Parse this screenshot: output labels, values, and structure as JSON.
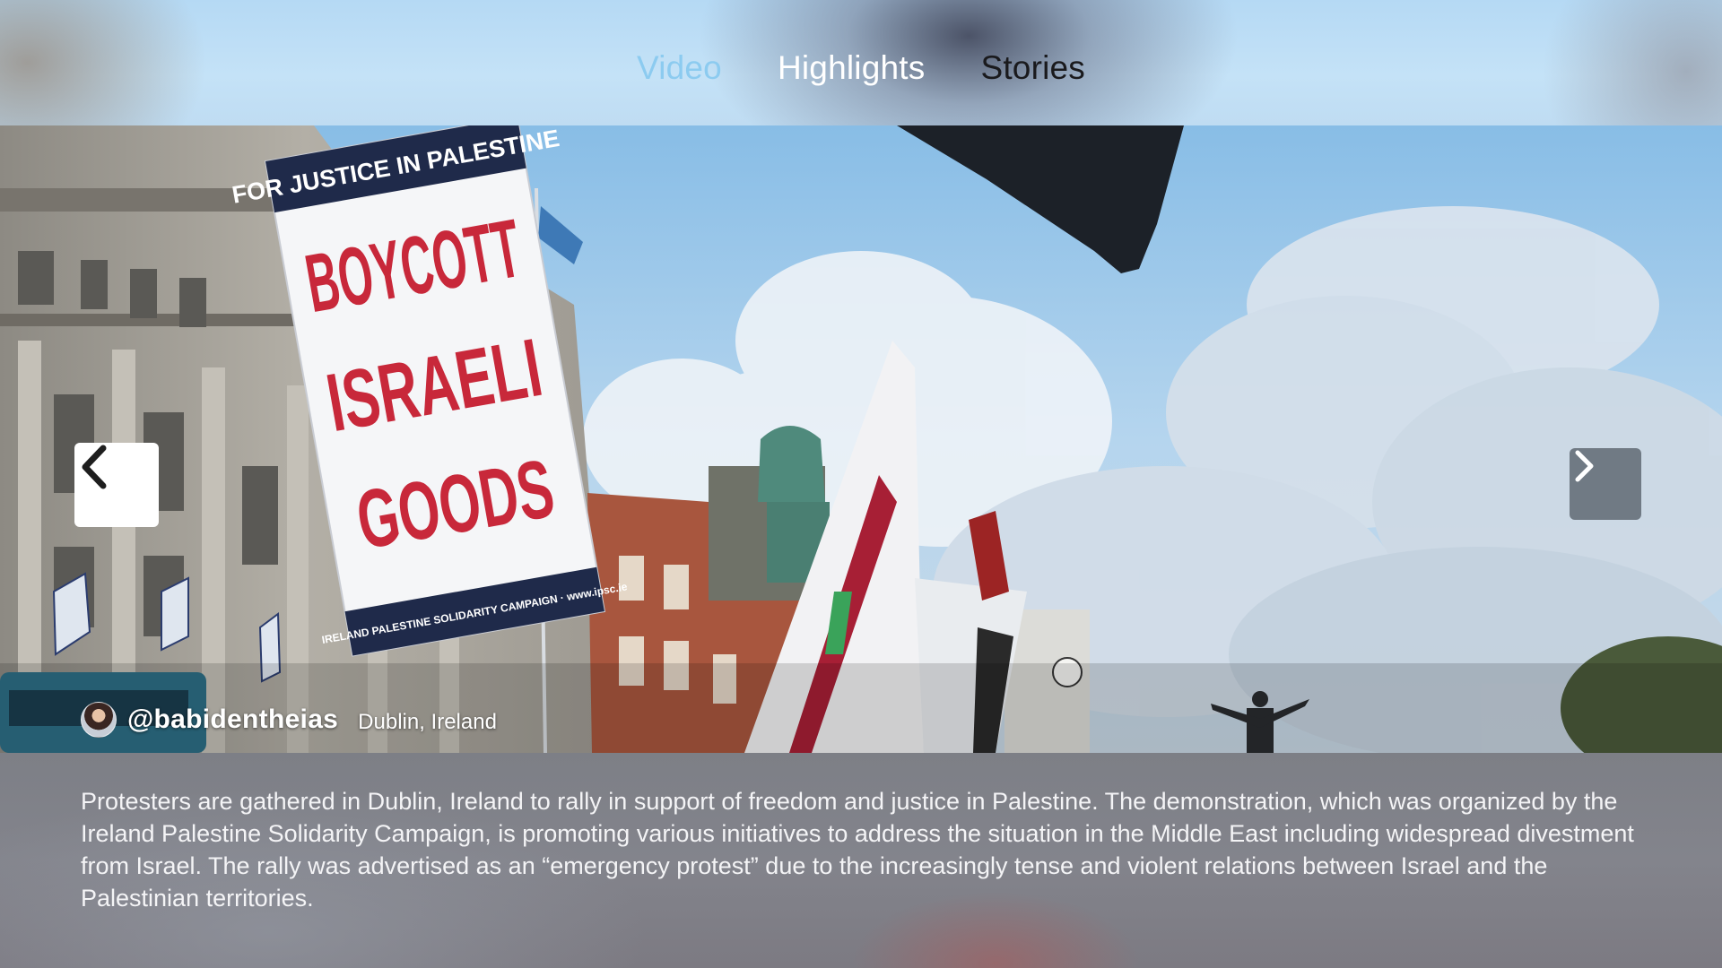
{
  "tabs": [
    {
      "label": "Video",
      "active": true
    },
    {
      "label": "Highlights",
      "active": false
    },
    {
      "label": "Stories",
      "active": false
    }
  ],
  "photo": {
    "sign": {
      "header": "FOR JUSTICE IN PALESTINE",
      "line1": "BOYCOTT",
      "line2": "ISRAELI",
      "line3": "GOODS",
      "footer": "IRELAND PALESTINE SOLIDARITY CAMPAIGN · www.ipsc.ie"
    }
  },
  "nav": {
    "prev_icon": "chevron-left-icon",
    "next_icon": "chevron-right-icon"
  },
  "credit": {
    "handle": "@babidentheias",
    "location": "Dublin, Ireland"
  },
  "caption": "Protesters are gathered in Dublin, Ireland to rally in support of freedom and justice in Palestine. The demonstration, which was organized by the Ireland Palestine Solidarity Campaign, is promoting various initiatives to address the situation in the Middle East including widespread divestment from Israel. The rally was advertised as an “emergency protest” due to the increasingly tense and violent relations between Israel and the Palestinian territories.",
  "colors": {
    "active_tab": "#8ccbf0",
    "sign_red": "#c8283a",
    "sign_navy": "#1f2a4a"
  }
}
